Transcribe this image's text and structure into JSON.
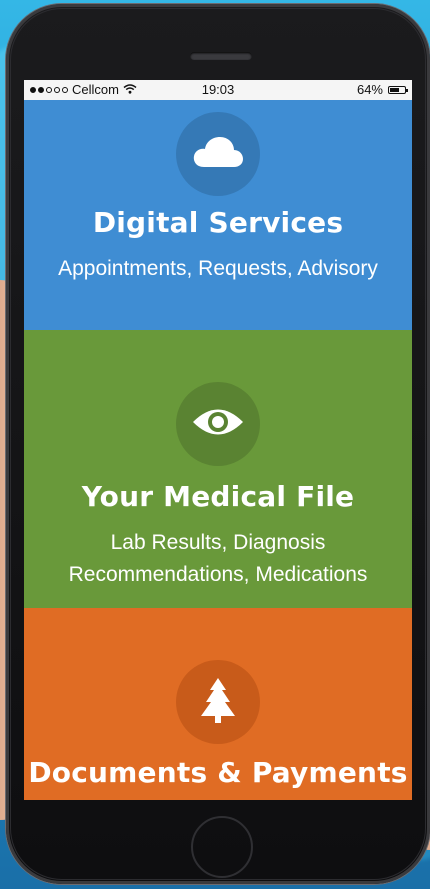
{
  "colors": {
    "digital_services": "#3f8dd3",
    "digital_services_icon_bg": "#3579b6",
    "medical_file": "#69993a",
    "medical_file_icon_bg": "#5a8332",
    "documents": "#e06c24",
    "documents_icon_bg": "#c85b1a",
    "status_bar": "#f5f5f5"
  },
  "status_bar": {
    "carrier": "Cellcom",
    "signal_dots_full": 2,
    "signal_dots_total": 5,
    "time": "19:03",
    "battery_percent_label": "64%",
    "battery_level": 0.64,
    "wifi_icon": "wifi-icon"
  },
  "sections": {
    "digital_services": {
      "icon": "cloud-icon",
      "title": "Digital Services",
      "subtitle_line1": "Appointments, Requests, Advisory"
    },
    "medical_file": {
      "icon": "eye-icon",
      "title": "Your Medical File",
      "subtitle_line1": "Lab Results, Diagnosis",
      "subtitle_line2": "Recommendations, Medications"
    },
    "documents_payments": {
      "icon": "tree-icon",
      "title": "Documents & Payments"
    }
  }
}
